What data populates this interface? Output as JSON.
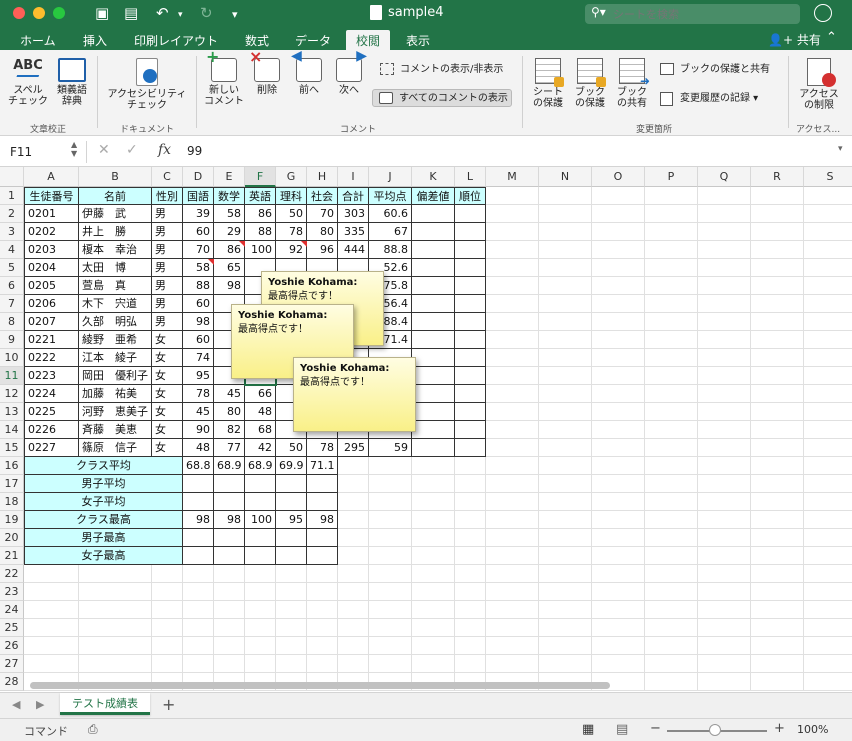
{
  "window": {
    "title": "sample4"
  },
  "search": {
    "placeholder": "シートを検索"
  },
  "tabs": [
    "ホーム",
    "挿入",
    "印刷レイアウト",
    "数式",
    "データ",
    "校閲",
    "表示"
  ],
  "active_tab": "校閲",
  "share_label": "共有",
  "ribbon": {
    "spell": "スペル\nチェック",
    "spell_abc": "ABC",
    "thesaurus": "類義語\n辞典",
    "group_proofing": "文章校正",
    "accessibility": "アクセシビリティ\nチェック",
    "group_document": "ドキュメント",
    "new_comment": "新しい\nコメント",
    "delete": "削除",
    "prev": "前へ",
    "next": "次へ",
    "show_hide_comment": "コメントの表示/非表示",
    "show_all_comments": "すべてのコメントの表示",
    "group_comments": "コメント",
    "protect_sheet": "シート\nの保護",
    "protect_book": "ブック\nの保護",
    "share_book": "ブック\nの共有",
    "protect_share_book": "ブックの保護と共有",
    "track_changes": "変更履歴の記録",
    "group_changes": "変更箇所",
    "restrict_access": "アクセス\nの制限",
    "group_access": "アクセス..."
  },
  "formula_bar": {
    "cell_ref": "F11",
    "value": "99",
    "fx": "fx"
  },
  "columns": [
    "A",
    "B",
    "C",
    "D",
    "E",
    "F",
    "G",
    "H",
    "I",
    "J",
    "K",
    "L",
    "M",
    "N",
    "O",
    "P",
    "Q",
    "R",
    "S"
  ],
  "rows": [
    "1",
    "2",
    "3",
    "4",
    "5",
    "6",
    "7",
    "8",
    "9",
    "10",
    "11",
    "12",
    "13",
    "14",
    "15",
    "16",
    "17",
    "18",
    "19",
    "20",
    "21",
    "22",
    "23",
    "24",
    "25",
    "26",
    "27",
    "28"
  ],
  "header_row": [
    "生徒番号",
    "名前",
    "性別",
    "国語",
    "数学",
    "英語",
    "理科",
    "社会",
    "合計",
    "平均点",
    "偏差値",
    "順位"
  ],
  "students": [
    [
      "0201",
      "伊藤　武",
      "男",
      "39",
      "58",
      "86",
      "50",
      "70",
      "303",
      "60.6"
    ],
    [
      "0202",
      "井上　勝",
      "男",
      "60",
      "29",
      "88",
      "78",
      "80",
      "335",
      "67"
    ],
    [
      "0203",
      "榎本　幸治",
      "男",
      "70",
      "86",
      "100",
      "92",
      "96",
      "444",
      "88.8"
    ],
    [
      "0204",
      "太田　博",
      "男",
      "58",
      "65",
      "",
      "",
      "",
      "",
      "52.6"
    ],
    [
      "0205",
      "萱島　真",
      "男",
      "88",
      "98",
      "",
      "",
      "",
      "",
      "75.8"
    ],
    [
      "0206",
      "木下　宍道",
      "男",
      "60",
      "",
      "",
      "",
      "",
      "",
      "56.4"
    ],
    [
      "0207",
      "久部　明弘",
      "男",
      "98",
      "",
      "",
      "",
      "",
      "",
      "88.4"
    ],
    [
      "0221",
      "綾野　亜希",
      "女",
      "60",
      "",
      "",
      "",
      "",
      "",
      "71.4"
    ],
    [
      "0222",
      "江本　綾子",
      "女",
      "74",
      "",
      "",
      "",
      "",
      "",
      "",
      ""
    ],
    [
      "0223",
      "岡田　優利子",
      "女",
      "95",
      "",
      "",
      "",
      "",
      "",
      ""
    ],
    [
      "0224",
      "加藤　祐美",
      "女",
      "78",
      "45",
      "66",
      "",
      "",
      "",
      ""
    ],
    [
      "0225",
      "河野　恵美子",
      "女",
      "45",
      "80",
      "48",
      "",
      "",
      "",
      ""
    ],
    [
      "0226",
      "斉藤　美恵",
      "女",
      "90",
      "82",
      "68",
      "",
      "",
      "",
      ""
    ],
    [
      "0227",
      "篠原　信子",
      "女",
      "48",
      "77",
      "42",
      "50",
      "78",
      "295",
      "59"
    ]
  ],
  "summary": [
    {
      "label": "クラス平均",
      "values": [
        "68.8",
        "68.9",
        "68.9",
        "69.9",
        "71.1"
      ]
    },
    {
      "label": "男子平均",
      "values": [
        "",
        "",
        "",
        "",
        ""
      ]
    },
    {
      "label": "女子平均",
      "values": [
        "",
        "",
        "",
        "",
        ""
      ]
    },
    {
      "label": "クラス最高",
      "values": [
        "98",
        "98",
        "100",
        "95",
        "98"
      ]
    },
    {
      "label": "男子最高",
      "values": [
        "",
        "",
        "",
        "",
        ""
      ]
    },
    {
      "label": "女子最高",
      "values": [
        "",
        "",
        "",
        "",
        ""
      ]
    }
  ],
  "comments": [
    {
      "author": "Yoshie Kohama:",
      "text": "最高得点です！"
    },
    {
      "author": "Yoshie Kohama:",
      "text": "最高得点です！"
    },
    {
      "author": "Yoshie Kohama:",
      "text": "最高得点です！"
    }
  ],
  "sheet_tab": "テスト成績表",
  "status": {
    "mode": "コマンド",
    "zoom": "100%"
  },
  "colors": {
    "accent": "#227447",
    "header_fill": "#ccffff",
    "note": "#f9f088"
  }
}
